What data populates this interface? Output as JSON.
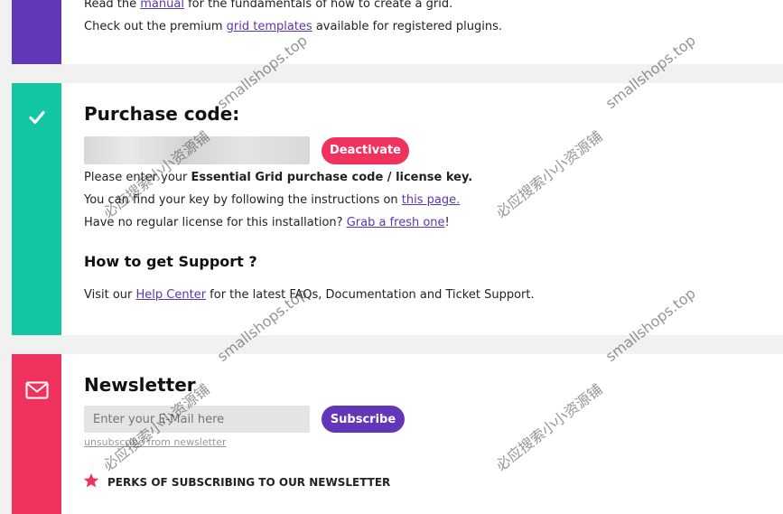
{
  "intro": {
    "line1_prefix": "Read the ",
    "line1_link": "manual",
    "line1_suffix": " for the fundamentals of how to create a grid.",
    "line2_prefix": "Check out the premium ",
    "line2_link": "grid templates",
    "line2_suffix": " available for registered plugins."
  },
  "purchase": {
    "title": "Purchase code:",
    "code_value": "",
    "deactivate_label": "Deactivate",
    "line1_prefix": "Please enter your ",
    "line1_bold": "Essential Grid purchase code / license key.",
    "line2_prefix": "You can find your key by following the instructions on ",
    "line2_link": "this page.",
    "line3_prefix": "Have no regular license for this installation? ",
    "line3_link": "Grab a fresh one",
    "line3_suffix": "!"
  },
  "support": {
    "title": "How to get Support ?",
    "text_prefix": "Visit our ",
    "text_link": "Help Center",
    "text_suffix": " for the latest FAQs, Documentation and Ticket Support."
  },
  "newsletter": {
    "title": "Newsletter",
    "email_placeholder": "Enter your E-Mail here",
    "subscribe_label": "Subscribe",
    "unsubscribe_link": "unsubscribe from newsletter",
    "perks_heading": "PERKS OF SUBSCRIBING TO OUR NEWSLETTER"
  },
  "watermarks": {
    "site": "smallshops.top",
    "cn": "必应搜索小小资源铺"
  },
  "colors": {
    "purple": "#6236b8",
    "teal": "#12c6a4",
    "pink": "#f0325e",
    "link": "#5b36b0"
  }
}
